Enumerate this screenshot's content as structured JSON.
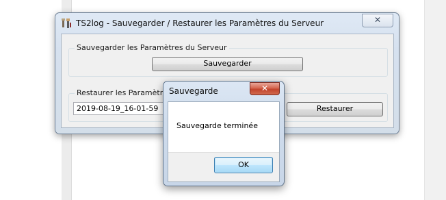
{
  "main_window": {
    "title": "TS2log - Sauvegarder / Restaurer les Paramètres du Serveur",
    "close_glyph": "✕",
    "backup_group": {
      "title": "Sauvegarder les Paramètres du Serveur",
      "button_label": "Sauvegarder"
    },
    "restore_group": {
      "title": "Restaurer les Paramètres",
      "selected_backup": "2019-08-19_16-01-59",
      "button_label": "Restaurer"
    }
  },
  "dialog": {
    "title": "Sauvegarde",
    "close_glyph": "✕",
    "message": "Sauvegarde terminée",
    "ok_label": "OK"
  }
}
